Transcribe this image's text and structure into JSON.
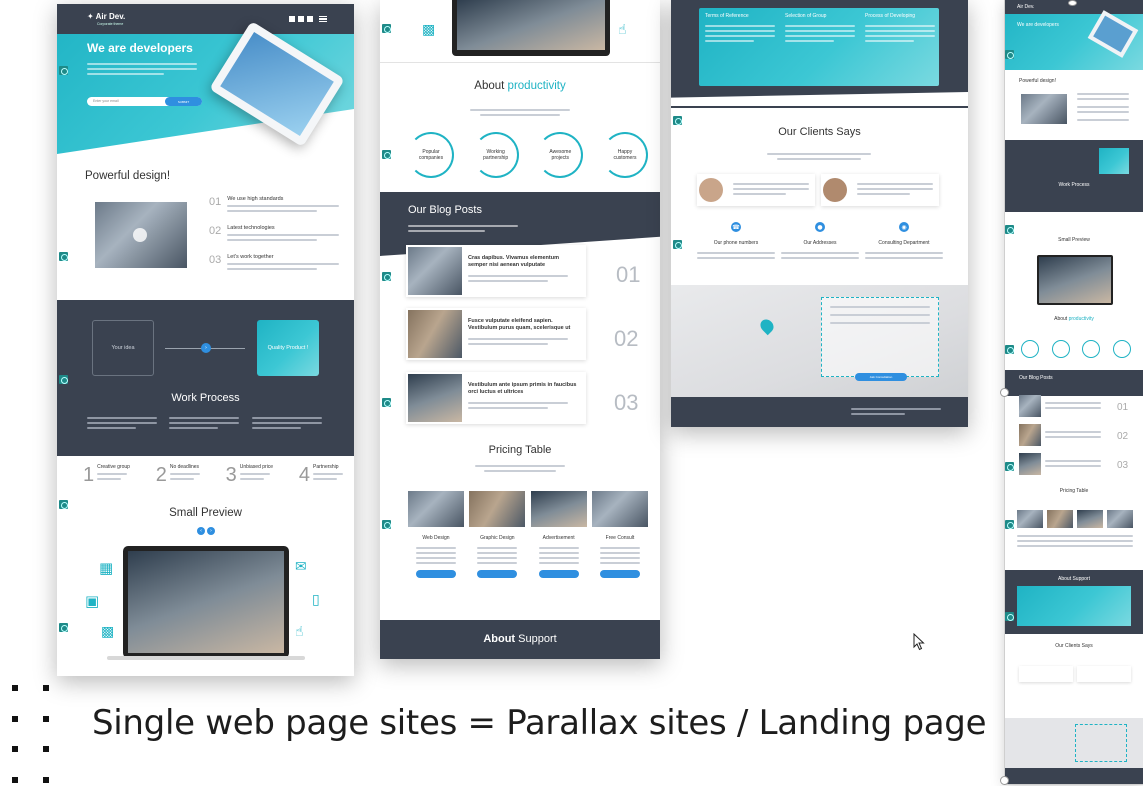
{
  "caption": "Single web page sites = Parallax sites / Landing page",
  "accent_color": "#1fb3c4",
  "dark_color": "#3a4250",
  "button_color": "#2f8fe0",
  "panel1": {
    "logo": "Air Dev.",
    "logo_sub": "Corporate theme",
    "hero_title": "We are developers",
    "search_placeholder": "Enter your email",
    "subscribe_label": "SUBMIT",
    "section_powerful": "Powerful design!",
    "features": [
      {
        "num": "01",
        "title": "We use high standards"
      },
      {
        "num": "02",
        "title": "Latest technologies"
      },
      {
        "num": "03",
        "title": "Let's work together"
      }
    ],
    "your_idea": "Your idea",
    "quality_product": "Quality Product !",
    "work_process": "Work Process",
    "stats": [
      {
        "num": "1",
        "title": "Creative group"
      },
      {
        "num": "2",
        "title": "No deadlines"
      },
      {
        "num": "3",
        "title": "Unbiased price"
      },
      {
        "num": "4",
        "title": "Partnership"
      }
    ],
    "small_preview": "Small Preview"
  },
  "panel2": {
    "about_title_a": "About",
    "about_title_b": "productivity",
    "circles": [
      {
        "label": "Popular companies"
      },
      {
        "label": "Working partnership"
      },
      {
        "label": "Awesome projects"
      },
      {
        "label": "Happy customers"
      }
    ],
    "blog_title": "Our Blog Posts",
    "posts": [
      {
        "title": "Cras dapibus. Vivamus elementum semper nisi aenean vulputate",
        "num": "01"
      },
      {
        "title": "Fusce vulputate eleifend sapien. Vestibulum purus quam, scelerisque ut",
        "num": "02"
      },
      {
        "title": "Vestibulum ante ipsum primis in faucibus orci luctus et ultrices",
        "num": "03"
      }
    ],
    "pricing_title": "Pricing Table",
    "plans": [
      "Web Design",
      "Graphic Design",
      "Advertisement",
      "Free Consult"
    ],
    "support_a": "About",
    "support_b": "Support"
  },
  "panel3": {
    "cols": [
      "Terms of Reference",
      "Selection of Group",
      "Process of Developing"
    ],
    "clients_title": "Our Clients Says",
    "contacts": [
      "Our phone numbers",
      "Our Addresses",
      "Consulting Department"
    ],
    "send_label": "Ask Consultation"
  },
  "panel4": {
    "logo": "Air Dev.",
    "hero_title": "We are developers",
    "powerful": "Powerful design!",
    "work_process": "Work Process",
    "small_preview": "Small Preview",
    "about_a": "About",
    "about_b": "productivity",
    "blog_title": "Our Blog Posts",
    "nums": [
      "01",
      "02",
      "03"
    ],
    "pricing": "Pricing Table",
    "about_support": "About Support",
    "clients": "Our Clients Says"
  }
}
